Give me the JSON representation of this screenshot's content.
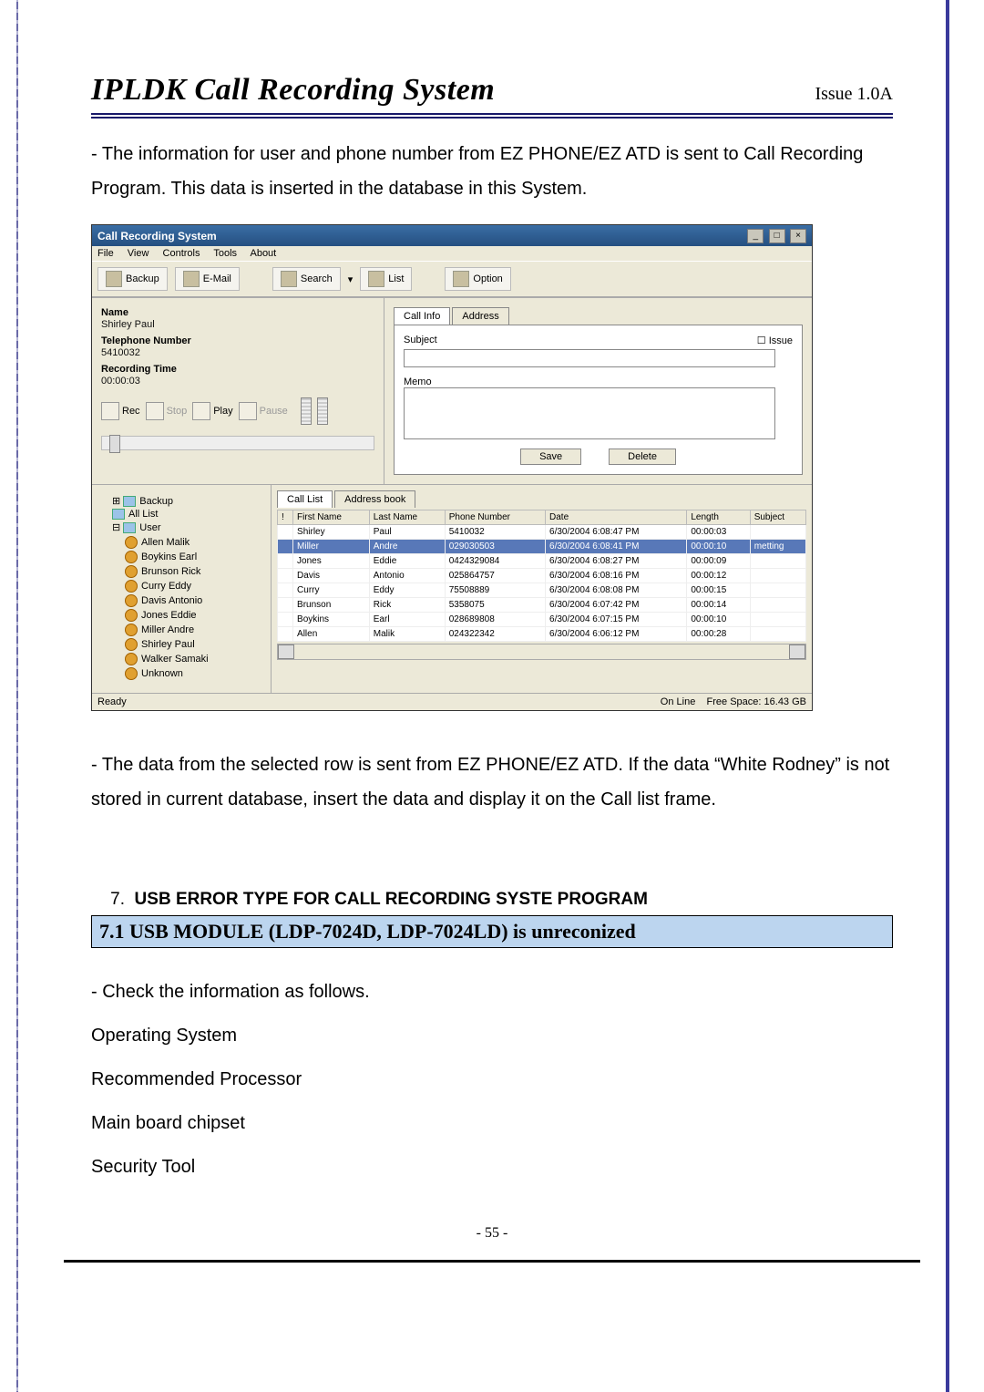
{
  "header": {
    "title": "IPLDK Call Recording System",
    "issue": "Issue 1.0A"
  },
  "para1": "- The information for user and phone number from EZ PHONE/EZ ATD is sent to Call Recording Program. This data is inserted in the database in this System.",
  "para2": "- The data from the selected row is sent from EZ PHONE/EZ ATD. If the data “White Rodney” is not stored in current database, insert the data and display it on the Call list frame.",
  "section7": {
    "num": "7.",
    "title": "USB ERROR TYPE FOR CALL RECORDING SYSTE PROGRAM",
    "sub": "7.1 USB MODULE (LDP-7024D, LDP-7024LD) is unreconized",
    "items": [
      "- Check the information as follows.",
      "Operating System",
      "Recommended Processor",
      "Main board chipset",
      "Security Tool"
    ]
  },
  "pagenum": "- 55 -",
  "app": {
    "title": "Call Recording System",
    "menus": [
      "File",
      "View",
      "Controls",
      "Tools",
      "About"
    ],
    "toolbar": {
      "backup": "Backup",
      "email": "E-Mail",
      "search": "Search",
      "list": "List",
      "option": "Option"
    },
    "info": {
      "name_lbl": "Name",
      "name_val": "Shirley Paul",
      "tel_lbl": "Telephone Number",
      "tel_val": "5410032",
      "rec_lbl": "Recording Time",
      "rec_val": "00:00:03"
    },
    "player": {
      "rec": "Rec",
      "stop": "Stop",
      "play": "Play",
      "pause": "Pause"
    },
    "tabs": {
      "callinfo": "Call Info",
      "address": "Address",
      "subject": "Subject",
      "memo": "Memo",
      "issue": "Issue",
      "save": "Save",
      "delete": "Delete"
    },
    "tree": {
      "backup": "Backup",
      "alllist": "All List",
      "user": "User",
      "users": [
        "Allen Malik",
        "Boykins Earl",
        "Brunson Rick",
        "Curry Eddy",
        "Davis Antonio",
        "Jones Eddie",
        "Miller Andre",
        "Shirley Paul",
        "Walker Samaki",
        "Unknown"
      ]
    },
    "gridtabs": {
      "calllist": "Call List",
      "addrbook": "Address book"
    },
    "cols": {
      "idx": "!",
      "fn": "First Name",
      "ln": "Last Name",
      "pn": "Phone Number",
      "dt": "Date",
      "len": "Length",
      "sub": "Subject"
    },
    "rows": [
      {
        "fn": "Shirley",
        "ln": "Paul",
        "pn": "5410032",
        "dt": "6/30/2004 6:08:47 PM",
        "len": "00:00:03",
        "sub": ""
      },
      {
        "fn": "Miller",
        "ln": "Andre",
        "pn": "029030503",
        "dt": "6/30/2004 6:08:41 PM",
        "len": "00:00:10",
        "sub": "metting",
        "sel": true
      },
      {
        "fn": "Jones",
        "ln": "Eddie",
        "pn": "0424329084",
        "dt": "6/30/2004 6:08:27 PM",
        "len": "00:00:09",
        "sub": ""
      },
      {
        "fn": "Davis",
        "ln": "Antonio",
        "pn": "025864757",
        "dt": "6/30/2004 6:08:16 PM",
        "len": "00:00:12",
        "sub": ""
      },
      {
        "fn": "Curry",
        "ln": "Eddy",
        "pn": "75508889",
        "dt": "6/30/2004 6:08:08 PM",
        "len": "00:00:15",
        "sub": ""
      },
      {
        "fn": "Brunson",
        "ln": "Rick",
        "pn": "5358075",
        "dt": "6/30/2004 6:07:42 PM",
        "len": "00:00:14",
        "sub": ""
      },
      {
        "fn": "Boykins",
        "ln": "Earl",
        "pn": "028689808",
        "dt": "6/30/2004 6:07:15 PM",
        "len": "00:00:10",
        "sub": ""
      },
      {
        "fn": "Allen",
        "ln": "Malik",
        "pn": "024322342",
        "dt": "6/30/2004 6:06:12 PM",
        "len": "00:00:28",
        "sub": ""
      }
    ],
    "status": {
      "ready": "Ready",
      "online": "On Line",
      "free": "Free Space: 16.43 GB"
    }
  }
}
